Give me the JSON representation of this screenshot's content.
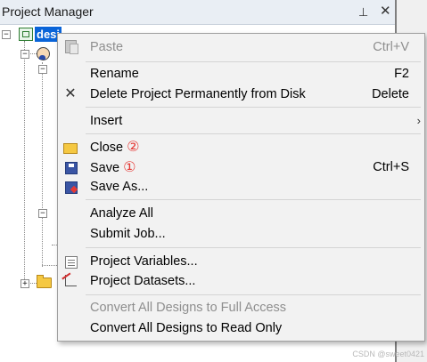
{
  "panel": {
    "title": "Project Manager",
    "pin_glyph": "⊥",
    "close_glyph": "✕",
    "root_label": "desi",
    "expander_minus": "−",
    "expander_plus": "+"
  },
  "menu": {
    "items": [
      {
        "label": "Paste",
        "shortcut": "Ctrl+V",
        "icon": "paste-icon",
        "enabled": false
      },
      {
        "label": "Rename",
        "shortcut": "F2",
        "icon": "",
        "enabled": true
      },
      {
        "label": "Delete Project Permanently from Disk",
        "shortcut": "Delete",
        "icon": "x-icon",
        "icon_glyph": "✕",
        "enabled": true
      },
      {
        "label": "Insert",
        "shortcut": "",
        "submenu_glyph": "›",
        "icon": "",
        "enabled": true
      },
      {
        "label": "Close",
        "badge": "②",
        "shortcut": "",
        "icon": "folder-icon",
        "enabled": true
      },
      {
        "label": "Save",
        "badge": "①",
        "shortcut": "Ctrl+S",
        "icon": "save-icon",
        "enabled": true
      },
      {
        "label": "Save As...",
        "shortcut": "",
        "icon": "save-as-icon",
        "enabled": true
      },
      {
        "label": "Analyze All",
        "shortcut": "",
        "icon": "",
        "enabled": true
      },
      {
        "label": "Submit Job...",
        "shortcut": "",
        "icon": "",
        "enabled": true
      },
      {
        "label": "Project Variables...",
        "shortcut": "",
        "icon": "variables-icon",
        "enabled": true
      },
      {
        "label": "Project Datasets...",
        "shortcut": "",
        "icon": "datasets-icon",
        "enabled": true
      },
      {
        "label": "Convert All Designs to Full Access",
        "shortcut": "",
        "icon": "",
        "enabled": false
      },
      {
        "label": "Convert All Designs to Read Only",
        "shortcut": "",
        "icon": "",
        "enabled": true
      }
    ]
  },
  "watermark": "CSDN @sweet0421",
  "colors": {
    "selection": "#0a64d8",
    "badge": "#e53935",
    "disabled_text": "#8e8e8e"
  }
}
